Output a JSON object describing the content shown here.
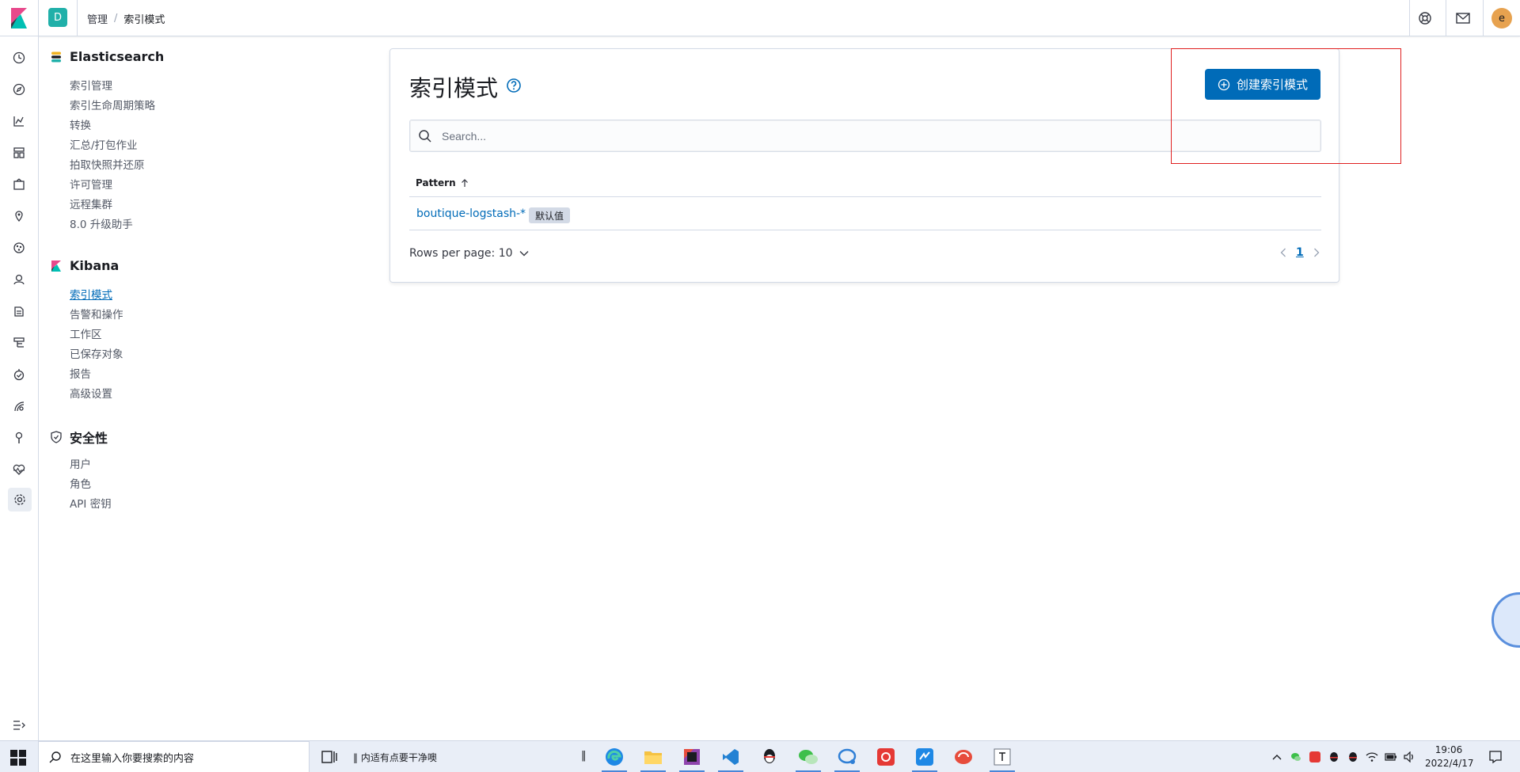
{
  "header": {
    "space_initial": "D",
    "breadcrumbs": [
      "管理",
      "索引模式"
    ],
    "breadcrumb_separator": "/",
    "user_initial": "e",
    "icons": [
      "help-menu-icon",
      "newsfeed-mail-icon"
    ]
  },
  "rail": {
    "icons": [
      "recent-clock-icon",
      "discover-compass-icon",
      "visualize-chart-icon",
      "dashboard-icon",
      "canvas-icon",
      "maps-icon",
      "ml-icon",
      "siem-icon",
      "logs-icon",
      "infrastructure-icon",
      "uptime-icon",
      "apm-icon",
      "dev-tools-icon",
      "monitoring-heart-icon",
      "management-gear-icon",
      "collapse-menu-icon"
    ]
  },
  "sidenav": {
    "sections": [
      {
        "title": "Elasticsearch",
        "icon": "elasticsearch-logo-icon",
        "items": [
          "索引管理",
          "索引生命周期策略",
          "转换",
          "汇总/打包作业",
          "拍取快照并还原",
          "许可管理",
          "远程集群",
          "8.0 升级助手"
        ]
      },
      {
        "title": "Kibana",
        "icon": "kibana-logo-icon",
        "items": [
          "索引模式",
          "告警和操作",
          "工作区",
          "已保存对象",
          "报告",
          "高级设置"
        ],
        "selected": "索引模式"
      },
      {
        "title": "安全性",
        "icon": "security-shield-icon",
        "items": [
          "用户",
          "角色",
          "API 密钥"
        ]
      }
    ]
  },
  "main": {
    "title": "索引模式",
    "create_button": "创建索引模式",
    "search_placeholder": "Search...",
    "table": {
      "column_header": "Pattern",
      "sort": "ascending",
      "rows": [
        {
          "pattern": "boutique-logstash-*",
          "badge": "默认值"
        }
      ]
    },
    "rows_per_page": "Rows per page: 10",
    "pagination": {
      "current_page": "1"
    }
  },
  "taskbar": {
    "search_placeholder": "在这里输入你要搜索的内容",
    "now_playing": "内适有点要干净噢",
    "apps": [
      "edge-browser-icon",
      "file-explorer-icon",
      "jetbrains-icon",
      "vscode-icon",
      "qq-icon",
      "wechat-icon",
      "chat-bubble-icon",
      "netease-music-icon",
      "app-blue-icon",
      "red-swirl-app-icon",
      "typora-icon"
    ],
    "clock_time": "19:06",
    "clock_date": "2022/4/17"
  },
  "colors": {
    "accent": "#006bb8",
    "annotation_box": "#e02020",
    "space_avatar": "#20b0a9",
    "user_avatar": "#e7a24f"
  }
}
